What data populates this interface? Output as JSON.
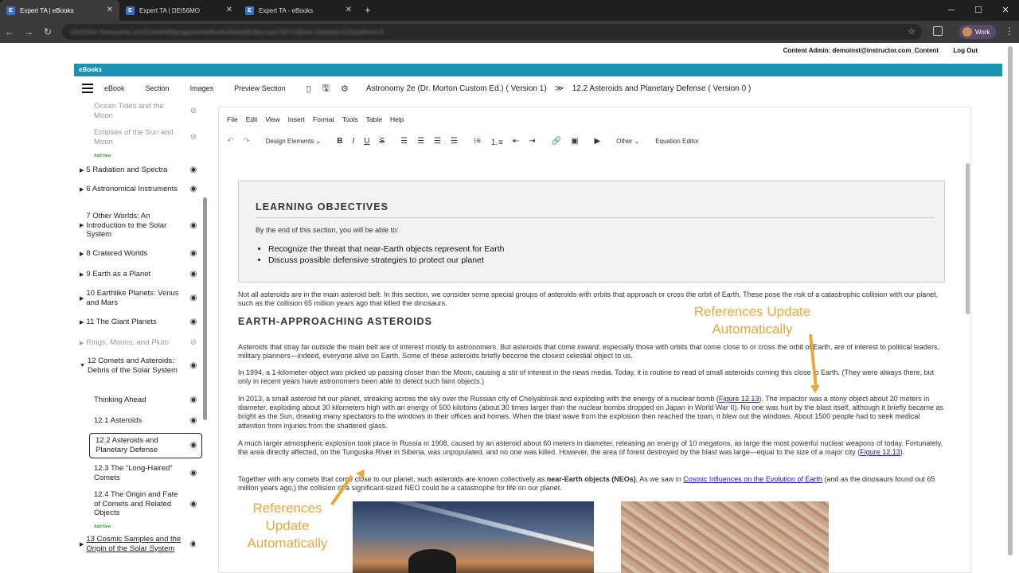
{
  "browser": {
    "tabs": [
      {
        "title": "Expert TA | eBooks",
        "active": true
      },
      {
        "title": "Expert TA | DEI56MO",
        "active": false
      },
      {
        "title": "Expert TA - eBooks",
        "active": false
      }
    ],
    "new_tab": "+",
    "url": "cdn62don.theexperta.com/ContentManagement/ebooks/EbookEditor.aspx?id=15&live=1&ebkid=2161&demo=0",
    "profile": "Work"
  },
  "header": {
    "user": "Content Admin: demoinst@instructor.com_Content",
    "logout": "Log Out",
    "ebooks_bar": "eBooks"
  },
  "toolbar": {
    "ebook": "eBook",
    "section": "Section",
    "images": "Images",
    "preview": "Preview Section",
    "breadcrumb_book": "Astronomy 2e (Dr. Morton Custom Ed.) ( Version 1)",
    "breadcrumb_sep": "≫",
    "breadcrumb_section": "12.2 Asteroids and Planetary Defense ( Version 0 )"
  },
  "sidebar": {
    "add_new": "Add New",
    "items": [
      {
        "label": "Ocean Tides and the Moon",
        "muted": true,
        "sub": true,
        "hidden": true
      },
      {
        "label": "Eclipses of the Sun and Moon",
        "muted": true,
        "sub": true,
        "hidden": true
      },
      {
        "label": "5 Radiation and Spectra"
      },
      {
        "label": "6 Astronomical Instruments"
      },
      {
        "label": "7 Other Worlds: An Introduction to the Solar System"
      },
      {
        "label": "8 Cratered Worlds"
      },
      {
        "label": "9 Earth as a Planet"
      },
      {
        "label": "10 Earthlike Planets: Venus and Mars"
      },
      {
        "label": "11 The Giant Planets"
      },
      {
        "label": "Rings, Moons, and Pluto",
        "muted": true,
        "hidden": true
      },
      {
        "label": "12 Comets and Asteroids: Debris of the Solar System",
        "expanded": true
      },
      {
        "label": "Thinking Ahead",
        "sub": true
      },
      {
        "label": "12.1 Asteroids",
        "sub": true
      },
      {
        "label": "12.2 Asteroids and Planetary Defense",
        "sub": true,
        "selected": true
      },
      {
        "label": "12.3 The “Long-Haired” Comets",
        "sub": true
      },
      {
        "label": "12.4 The Origin and Fate of Comets and Related Objects",
        "sub": true
      },
      {
        "label": "13 Cosmic Samples and the Origin of the Solar System"
      }
    ]
  },
  "editor": {
    "menus": [
      "File",
      "Edit",
      "View",
      "Insert",
      "Format",
      "Tools",
      "Table",
      "Help"
    ],
    "design_elements": "Design Elements",
    "other": "Other",
    "equation_editor": "Equation Editor"
  },
  "doc": {
    "lo_title": "LEARNING OBJECTIVES",
    "lo_intro": "By the end of this section, you will be able to:",
    "lo_items": [
      "Recognize the threat that near-Earth objects represent for Earth",
      "Discuss possible defensive strategies to protect our planet"
    ],
    "p1": "Not all asteroids are in the main asteroid belt. In this section, we consider some special groups of asteroids with orbits that approach or cross the orbit of Earth. These pose the risk of a catastrophic collision with our planet, such as the collision 65 million years ago that killed the dinosaurs.",
    "h2": "EARTH-APPROACHING ASTEROIDS",
    "p2_a": "Asteroids that stray far ",
    "p2_em1": "outside",
    "p2_b": " the main belt are of interest mostly to astronomers. But asteroids that come ",
    "p2_em2": "inward",
    "p2_c": ", especially those with orbits that come close to or cross the orbit of Earth, are of interest to political leaders, military planners—indeed, everyone alive on Earth. Some of these asteroids briefly become the closest celestial object to us.",
    "p3": "In 1994, a 1-kilometer object was picked up passing closer than the Moon, causing a stir of interest in the news media. Today, it is routine to read of small asteroids coming this close to Earth. (They were always there, but only in recent years have astronomers been able to detect such faint objects.)",
    "p4_a": "In 2013, a small asteroid hit our planet, streaking across the sky over the Russian city of Chelyabinsk and exploding with the energy of a nuclear bomb (",
    "p4_link": "Figure 12.13",
    "p4_b": "). The impactor was a stony object about 20 meters in diameter, exploding about 30 kilometers high with an energy of 500 kilotons (about 30 times larger than the nuclear bombs dropped on Japan in World War II). No one was hurt by the blast itself, although it briefly became as bright as the Sun, drawing many spectators to the windows in their offices and homes. When the blast wave from the explosion then reached the town, it blew out the windows. About 1500 people had to seek medical attention from injuries from the shattered glass.",
    "p5_a": "A much larger atmospheric explosion took place in Russia in 1908, caused by an asteroid about 60 meters in diameter, releasing an energy of 10 megatons, as large the most powerful nuclear weapons of today. Fortunately, the area directly affected, on the Tunguska River in Siberia, was unpopulated, and no one was killed. However, the area of forest destroyed by the blast was large—equal to the size of a major city (",
    "p5_link": "Figure 12.13",
    "p5_b": ").",
    "p6_a": "Together with any comets that come close to our planet, such asteroids are known collectively as ",
    "p6_bold": "near-Earth objects (NEOs)",
    "p6_b": ". As we saw in ",
    "p6_link": "Cosmic Influences on the Evolution of Earth",
    "p6_c": " (and as the dinosaurs found out 65 million years ago,) the collision of a significant-sized NEO could be a catastrophe for life on our planet."
  },
  "annotations": {
    "top": [
      "References Update",
      "Automatically"
    ],
    "bottom": [
      "References",
      "Update",
      "Automatically"
    ]
  },
  "colors": {
    "accent_bar": "#1a93b0",
    "annotation": "#e8a93a",
    "link": "#1a1aa6"
  }
}
